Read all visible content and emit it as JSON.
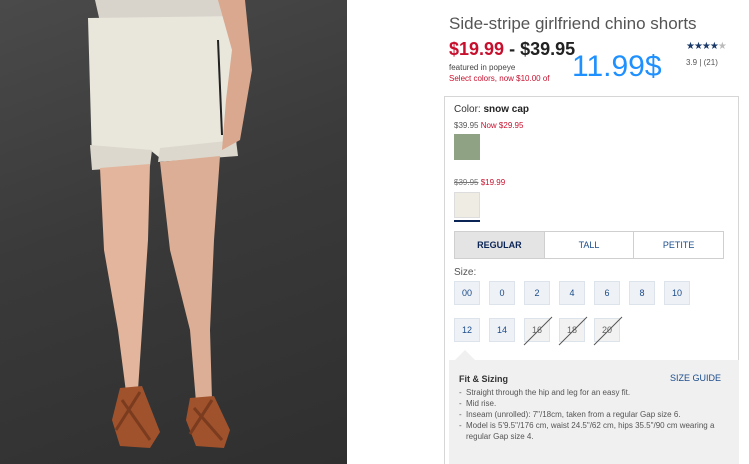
{
  "product": {
    "title": "Side-stripe girlfriend chino shorts",
    "price_sale": "$19.99",
    "price_separator": "-",
    "price_orig": "$39.95",
    "featured": "featured in popeye",
    "promo": "Select colors, now $10.00 of",
    "overlay_price": "11.99$",
    "rating_stars": "★★★★",
    "rating_star_empty": "★",
    "rating_text": "3.9  |  (21)"
  },
  "color": {
    "label": "Color:",
    "value": "snow cap",
    "swatch1_orig": "$39.95",
    "swatch1_now": "Now $29.95",
    "swatch2_orig": "$39.95",
    "swatch2_now": "$19.99",
    "swatch1_color": "#8fa283",
    "swatch2_color": "#efece3"
  },
  "fits": [
    "REGULAR",
    "TALL",
    "PETITE"
  ],
  "size": {
    "label": "Size:",
    "row1": [
      "00",
      "0",
      "2",
      "4",
      "6",
      "8",
      "10"
    ],
    "row2": [
      "12",
      "14",
      "16",
      "18",
      "20"
    ]
  },
  "fit_sizing": {
    "title": "Fit & Sizing",
    "size_guide": "SIZE GUIDE",
    "items": [
      "Straight through the hip and leg for an easy fit.",
      "Mid rise.",
      "Inseam (unrolled): 7\"/18cm, taken from a regular Gap size 6.",
      "Model is 5'9.5\"/176 cm, waist 24.5\"/62 cm, hips 35.5\"/90 cm wearing a regular Gap size 4."
    ]
  },
  "colors": {
    "sale": "#c8102e",
    "link": "#1a4c8c",
    "overlay": "#1e90ff"
  }
}
